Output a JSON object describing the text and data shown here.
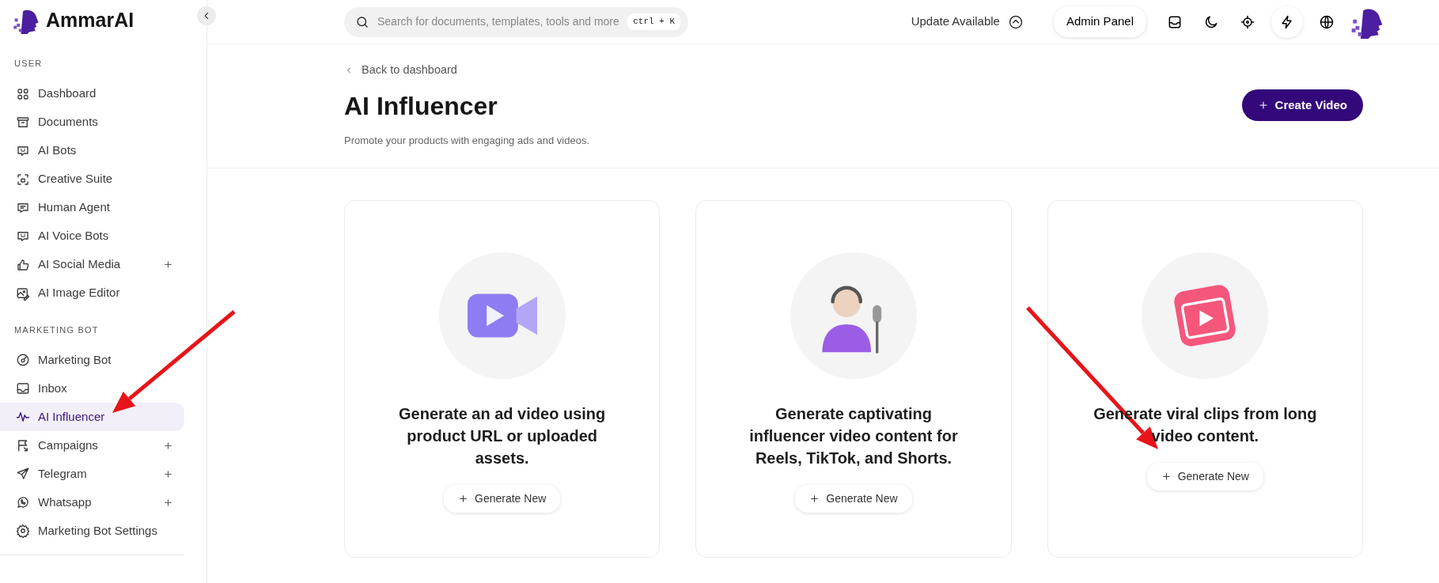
{
  "brand": "AmmarAI",
  "sidebar": {
    "sections": [
      {
        "heading": "USER",
        "items": [
          {
            "label": "Dashboard",
            "expandable": false,
            "selected": false
          },
          {
            "label": "Documents",
            "expandable": false,
            "selected": false
          },
          {
            "label": "AI Bots",
            "expandable": false,
            "selected": false
          },
          {
            "label": "Creative Suite",
            "expandable": false,
            "selected": false
          },
          {
            "label": "Human Agent",
            "expandable": false,
            "selected": false
          },
          {
            "label": "AI Voice Bots",
            "expandable": false,
            "selected": false
          },
          {
            "label": "AI Social Media",
            "expandable": true,
            "selected": false
          },
          {
            "label": "AI Image Editor",
            "expandable": false,
            "selected": false
          }
        ]
      },
      {
        "heading": "MARKETING BOT",
        "items": [
          {
            "label": "Marketing Bot",
            "expandable": false,
            "selected": false
          },
          {
            "label": "Inbox",
            "expandable": false,
            "selected": false
          },
          {
            "label": "AI Influencer",
            "expandable": false,
            "selected": true
          },
          {
            "label": "Campaigns",
            "expandable": true,
            "selected": false
          },
          {
            "label": "Telegram",
            "expandable": true,
            "selected": false
          },
          {
            "label": "Whatsapp",
            "expandable": true,
            "selected": false
          },
          {
            "label": "Marketing Bot Settings",
            "expandable": false,
            "selected": false
          }
        ]
      }
    ]
  },
  "topbar": {
    "search": {
      "placeholder": "Search for documents, templates, tools and more",
      "shortcut": "ctrl + K"
    },
    "update": "Update Available",
    "admin": "Admin Panel"
  },
  "header": {
    "back": "Back to dashboard",
    "title": "AI Influencer",
    "subtitle": "Promote your products with engaging ads and videos.",
    "action": "Create Video"
  },
  "cards": [
    {
      "title": "Generate an ad video using product URL or uploaded assets.",
      "button": "Generate New"
    },
    {
      "title": "Generate captivating influencer video content for Reels, TikTok, and Shorts.",
      "button": "Generate New"
    },
    {
      "title": "Generate viral clips from long video content.",
      "button": "Generate New"
    }
  ]
}
